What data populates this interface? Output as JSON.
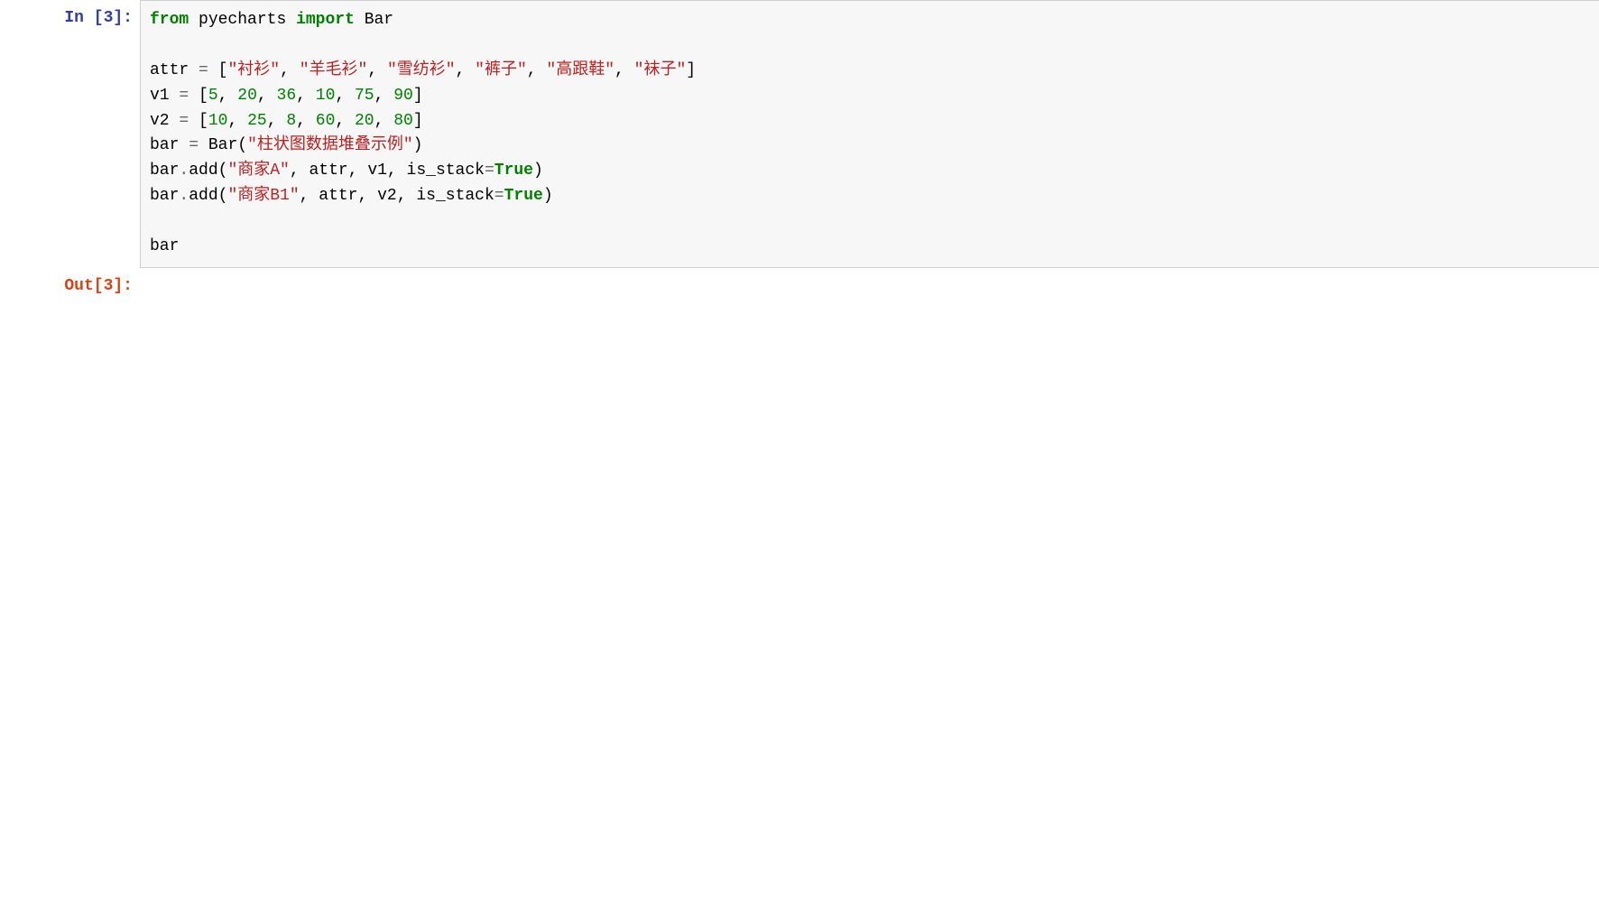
{
  "cells": {
    "input": {
      "execution_count": 3,
      "prompt": "In [3]:",
      "code": {
        "line1": {
          "kw_from": "from",
          "mod": "pyecharts",
          "kw_import": "import",
          "cls": "Bar"
        },
        "line3": {
          "var": "attr",
          "eq": "=",
          "lb": "[",
          "s1": "\"衬衫\"",
          "c1": ",",
          "s2": "\"羊毛衫\"",
          "c2": ",",
          "s3": "\"雪纺衫\"",
          "c3": ",",
          "s4": "\"裤子\"",
          "c4": ",",
          "s5": "\"高跟鞋\"",
          "c5": ",",
          "s6": "\"袜子\"",
          "rb": "]"
        },
        "line4": {
          "var": "v1",
          "eq": "=",
          "lb": "[",
          "n1": "5",
          "c1": ",",
          "n2": "20",
          "c2": ",",
          "n3": "36",
          "c3": ",",
          "n4": "10",
          "c4": ",",
          "n5": "75",
          "c5": ",",
          "n6": "90",
          "rb": "]"
        },
        "line5": {
          "var": "v2",
          "eq": "=",
          "lb": "[",
          "n1": "10",
          "c1": ",",
          "n2": "25",
          "c2": ",",
          "n3": "8",
          "c3": ",",
          "n4": "60",
          "c4": ",",
          "n5": "20",
          "c5": ",",
          "n6": "80",
          "rb": "]"
        },
        "line6": {
          "var": "bar",
          "eq": "=",
          "cls": "Bar",
          "lp": "(",
          "s1": "\"柱状图数据堆叠示例\"",
          "rp": ")"
        },
        "line7": {
          "obj": "bar",
          "dot": ".",
          "meth": "add",
          "lp": "(",
          "s1": "\"商家A\"",
          "c1": ",",
          "a1": "attr",
          "c2": ",",
          "a2": "v1",
          "c3": ",",
          "kw": "is_stack",
          "eq": "=",
          "val": "True",
          "rp": ")"
        },
        "line8": {
          "obj": "bar",
          "dot": ".",
          "meth": "add",
          "lp": "(",
          "s1": "\"商家B1\"",
          "c1": ",",
          "a1": "attr",
          "c2": ",",
          "a2": "v2",
          "c3": ",",
          "kw": "is_stack",
          "eq": "=",
          "val": "True",
          "rp": ")"
        },
        "line10": {
          "var": "bar"
        }
      }
    },
    "output": {
      "execution_count": 3,
      "prompt": "Out[3]:"
    }
  }
}
